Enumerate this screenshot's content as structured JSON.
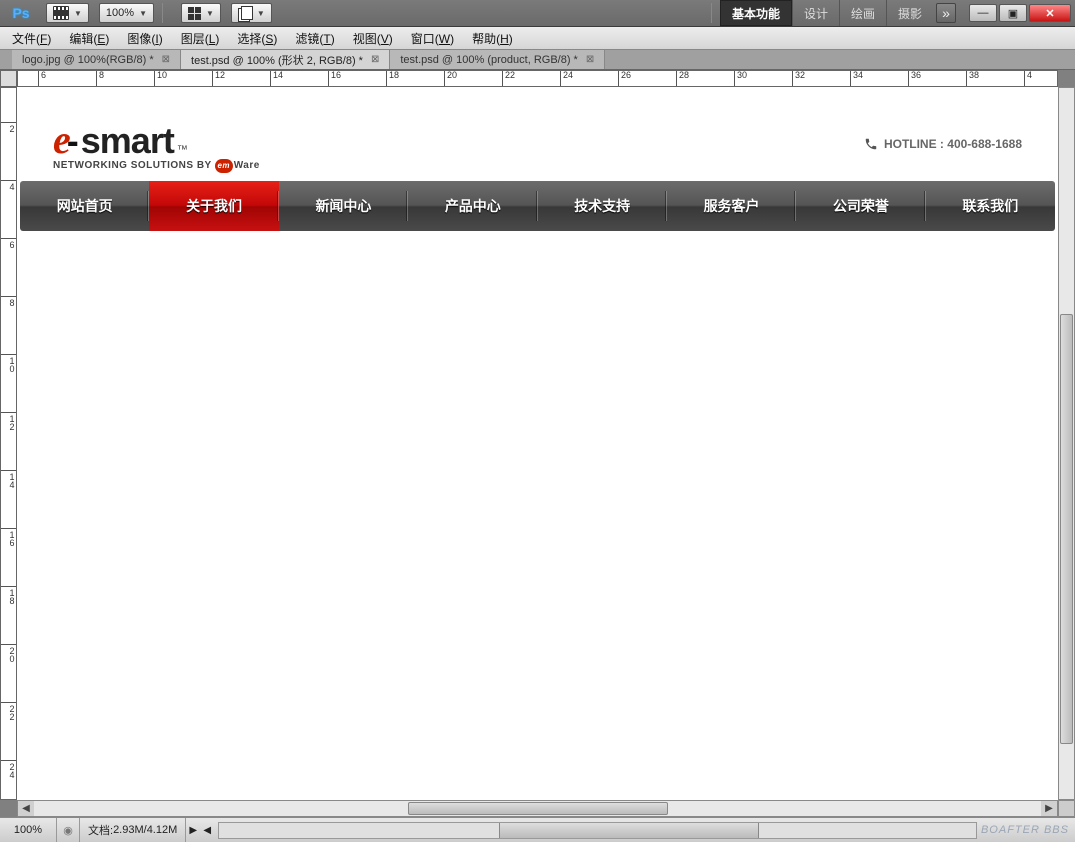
{
  "app": {
    "logo": "Ps",
    "zoom": "100%"
  },
  "workspaces": [
    {
      "label": "基本功能",
      "active": true
    },
    {
      "label": "设计",
      "active": false
    },
    {
      "label": "绘画",
      "active": false
    },
    {
      "label": "摄影",
      "active": false
    }
  ],
  "menus": [
    {
      "label": "文件",
      "key": "F"
    },
    {
      "label": "编辑",
      "key": "E"
    },
    {
      "label": "图像",
      "key": "I"
    },
    {
      "label": "图层",
      "key": "L"
    },
    {
      "label": "选择",
      "key": "S"
    },
    {
      "label": "滤镜",
      "key": "T"
    },
    {
      "label": "视图",
      "key": "V"
    },
    {
      "label": "窗口",
      "key": "W"
    },
    {
      "label": "帮助",
      "key": "H"
    }
  ],
  "tabs": [
    {
      "label": "logo.jpg @ 100%(RGB/8) *",
      "active": false
    },
    {
      "label": "test.psd @ 100% (形状 2, RGB/8) *",
      "active": true
    },
    {
      "label": "test.psd @ 100% (product, RGB/8) *",
      "active": false
    }
  ],
  "ruler_h": [
    "6",
    "8",
    "10",
    "12",
    "14",
    "16",
    "18",
    "20",
    "22",
    "24",
    "26",
    "28",
    "30",
    "32",
    "34",
    "36",
    "38",
    "4"
  ],
  "ruler_v": [
    "2",
    "4",
    "6",
    "8",
    "10",
    "12",
    "14",
    "16",
    "18",
    "20",
    "22",
    "24"
  ],
  "site": {
    "logo_e": "e",
    "logo_rest": "smart",
    "logo_tm": "™",
    "tagline_pre": "NETWORKING SOLUTIONS BY",
    "tagline_em": "em",
    "tagline_post": "Ware",
    "hotline": "HOTLINE : 400-688-1688",
    "nav": [
      {
        "label": "网站首页",
        "active": false
      },
      {
        "label": "关于我们",
        "active": true
      },
      {
        "label": "新闻中心",
        "active": false
      },
      {
        "label": "产品中心",
        "active": false
      },
      {
        "label": "技术支持",
        "active": false
      },
      {
        "label": "服务客户",
        "active": false
      },
      {
        "label": "公司荣誉",
        "active": false
      },
      {
        "label": "联系我们",
        "active": false
      }
    ]
  },
  "status": {
    "zoom": "100%",
    "doc_label": "文档:",
    "doc_size": "2.93M/4.12M"
  },
  "watermark": "BOAFTER BBS"
}
